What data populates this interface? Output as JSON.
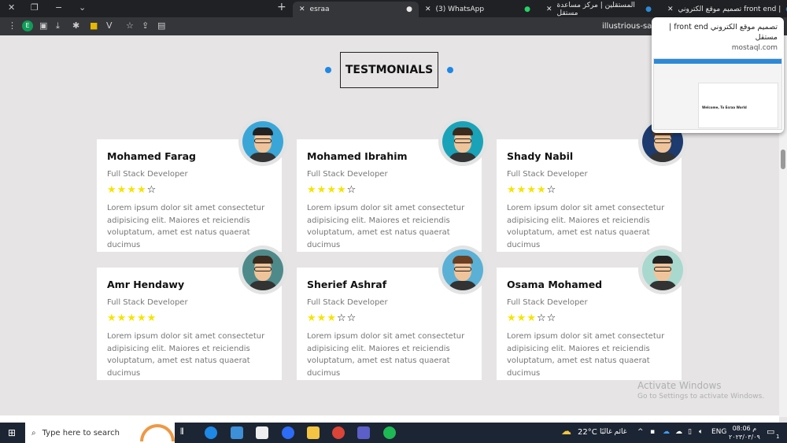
{
  "browser": {
    "tabs": [
      {
        "label": "esraa",
        "active": true
      },
      {
        "label": "(3) WhatsApp",
        "active": false
      },
      {
        "label": "المستقلين | مركز مساعدة مستقل",
        "active": false
      },
      {
        "label": "تصميم موقع الكتروني front end |",
        "active": false
      }
    ],
    "new_tab": "+",
    "url": "illustrious-sable",
    "profile_initial": "E",
    "hover_card": {
      "title": "تصميم موقع الكتروني front end | مستقل",
      "domain": "mostaql.com",
      "preview_text": "Welcome, To Esraa World"
    }
  },
  "section": {
    "title": "TESTMONIALS"
  },
  "testimonials": [
    {
      "name": "Mohamed Farag",
      "role": "Full Stack Developer",
      "rating": 4,
      "text": "Lorem ipsum dolor sit amet consectetur adipisicing elit. Maiores et reiciendis voluptatum, amet est natus quaerat ducimus",
      "avatar_bg": "#3aa6d8",
      "hair": "#222"
    },
    {
      "name": "Mohamed Ibrahim",
      "role": "Full Stack Developer",
      "rating": 4,
      "text": "Lorem ipsum dolor sit amet consectetur adipisicing elit. Maiores et reiciendis voluptatum, amet est natus quaerat ducimus",
      "avatar_bg": "#1aa3b8",
      "hair": "#3b2a1e"
    },
    {
      "name": "Shady Nabil",
      "role": "Full Stack Developer",
      "rating": 4,
      "text": "Lorem ipsum dolor sit amet consectetur adipisicing elit. Maiores et reiciendis voluptatum, amet est natus quaerat ducimus",
      "avatar_bg": "#1d3b6e",
      "hair": "#5a3a22"
    },
    {
      "name": "Amr Hendawy",
      "role": "Full Stack Developer",
      "rating": 5,
      "text": "Lorem ipsum dolor sit amet consectetur adipisicing elit. Maiores et reiciendis voluptatum, amet est natus quaerat ducimus",
      "avatar_bg": "#4f8a8b",
      "hair": "#3b2a1e"
    },
    {
      "name": "Sherief Ashraf",
      "role": "Full Stack Developer",
      "rating": 3,
      "text": "Lorem ipsum dolor sit amet consectetur adipisicing elit. Maiores et reiciendis voluptatum, amet est natus quaerat ducimus",
      "avatar_bg": "#5bb0d6",
      "hair": "#6b3f22"
    },
    {
      "name": "Osama Mohamed",
      "role": "Full Stack Developer",
      "rating": 3,
      "text": "Lorem ipsum dolor sit amet consectetur adipisicing elit. Maiores et reiciendis voluptatum, amet est natus quaerat ducimus",
      "avatar_bg": "#a9d8cf",
      "hair": "#222"
    }
  ],
  "watermark": {
    "title": "Activate Windows",
    "subtitle": "Go to Settings to activate Windows."
  },
  "taskbar": {
    "search_placeholder": "Type here to search",
    "weather": "22°C",
    "weather_text": "غائم غالبًا",
    "lang": "ENG",
    "time": "08:06 م",
    "date": "٢٠٢٣/٠٣/٠٩",
    "notification_count": "1"
  }
}
